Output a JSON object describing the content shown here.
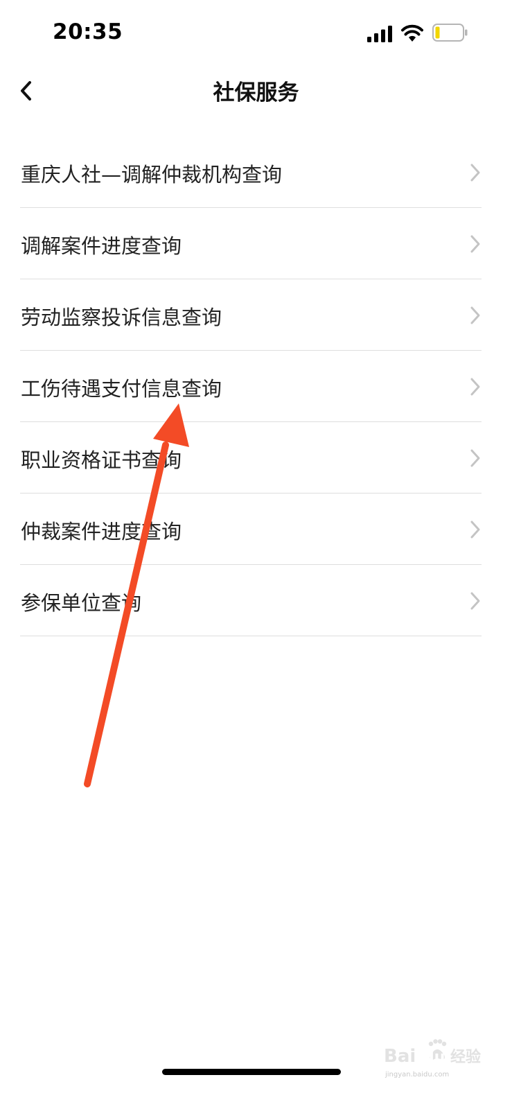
{
  "status_bar": {
    "time": "20:35",
    "icons": [
      "signal-icon",
      "wifi-icon",
      "battery-icon"
    ],
    "battery_color": "#f2d600"
  },
  "nav": {
    "title": "社保服务",
    "back_icon": "chevron-left-icon"
  },
  "menu": {
    "items": [
      {
        "label": "重庆人社—调解仲裁机构查询"
      },
      {
        "label": "调解案件进度查询"
      },
      {
        "label": "劳动监察投诉信息查询"
      },
      {
        "label": "工伤待遇支付信息查询"
      },
      {
        "label": "职业资格证书查询"
      },
      {
        "label": "仲裁案件进度查询"
      },
      {
        "label": "参保单位查询"
      }
    ],
    "item_icon": "chevron-right-icon"
  },
  "annotation": {
    "type": "arrow",
    "color": "#f34b26",
    "points_to": "工伤待遇支付信息查询"
  },
  "watermark": {
    "logo": "Baidu 经验",
    "subtext": "jingyan.baidu.com"
  }
}
